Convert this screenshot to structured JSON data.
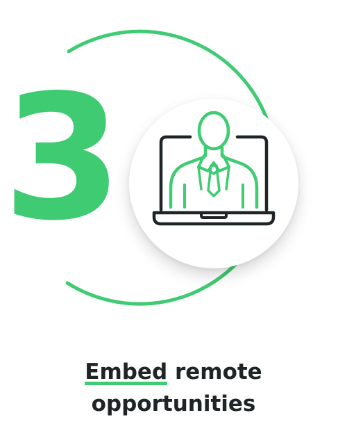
{
  "step": {
    "number": "3"
  },
  "icon": {
    "name": "remote-worker-laptop-icon"
  },
  "caption": {
    "highlight": "Embed",
    "line1_rest": " remote",
    "line2": "opportunities"
  },
  "colors": {
    "accent": "#3ecb72",
    "text": "#1f2427",
    "icon_stroke": "#1f2427",
    "background": "#ffffff"
  }
}
